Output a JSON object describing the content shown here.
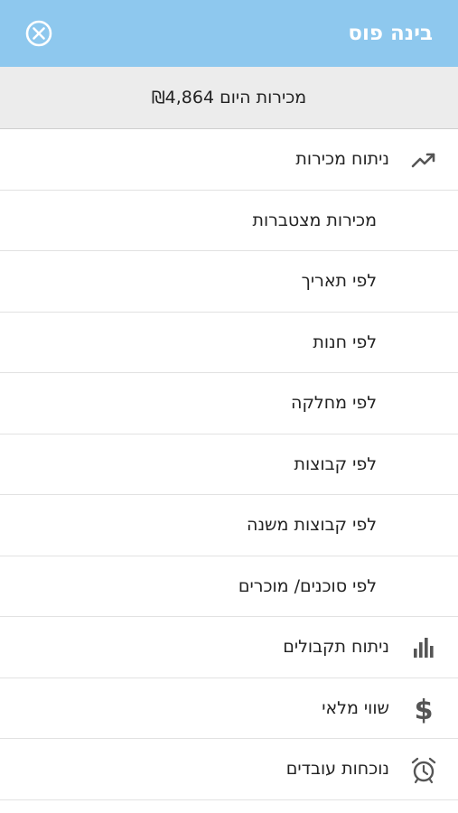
{
  "header": {
    "title": "בינה פוס",
    "close_icon": "close-circle-icon",
    "background": "#8ec8ee"
  },
  "sales": {
    "prefix": "מכירות היום",
    "amount": "₪4,864"
  },
  "menu": {
    "items": [
      {
        "label": "ניתוח מכירות",
        "icon": "trending-up-icon"
      },
      {
        "label": "מכירות מצטברות"
      },
      {
        "label": "לפי תאריך"
      },
      {
        "label": "לפי חנות"
      },
      {
        "label": "לפי מחלקה"
      },
      {
        "label": "לפי קבוצות"
      },
      {
        "label": "לפי קבוצות משנה"
      },
      {
        "label": "לפי סוכנים/ מוכרים"
      },
      {
        "label": "ניתוח תקבולים",
        "icon": "bar-chart-icon"
      },
      {
        "label": "שווי מלאי",
        "icon": "dollar-icon"
      },
      {
        "label": "נוכחות עובדים",
        "icon": "alarm-clock-icon"
      }
    ]
  }
}
